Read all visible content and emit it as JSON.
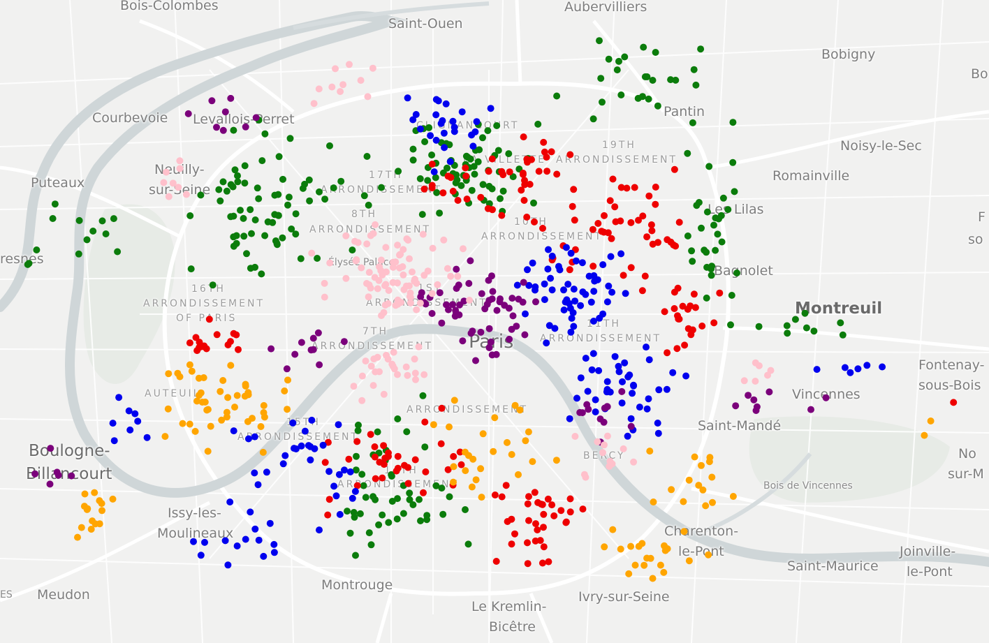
{
  "map": {
    "labels": {
      "bois_colombes": "Bois-Colombes",
      "saint_ouen": "Saint-Ouen",
      "aubervilliers": "Aubervilliers",
      "bobigny": "Bobigny",
      "bo": "Bo",
      "courbevoie": "Courbevoie",
      "levallois": "Levallois-Perret",
      "pantin": "Pantin",
      "noisy": "Noisy-le-Sec",
      "neuilly1": "Neuilly-",
      "neuilly2": "sur-Seine",
      "puteaux": "Puteaux",
      "romainville": "Romainville",
      "les_lilas": "Les Lilas",
      "resnes": "resnes",
      "elysee": "Élysée Palace",
      "bagnolet": "Bagnolet",
      "montreuil": "Montreuil",
      "paris": "Paris",
      "fontenay1": "Fontenay-",
      "fontenay2": "sous-Bois",
      "vincennes": "Vincennes",
      "saint_mande": "Saint-Mandé",
      "boulogne1": "Boulogne-",
      "boulogne2": "Billancourt",
      "bercy": "BERCY",
      "bois_vincennes": "Bois de Vincennes",
      "no1": "No",
      "no2": "sur-M",
      "issy1": "Issy-les-",
      "issy2": "Moulineaux",
      "charenton1": "Charenton-",
      "charenton2": "le-Pont",
      "joinville1": "Joinville-",
      "joinville2": "le-Pont",
      "saint_maurice": "Saint-Maurice",
      "es": "ES",
      "meudon": "Meudon",
      "montrouge": "Montrouge",
      "kremlin1": "Le Kremlin-",
      "kremlin2": "Bicêtre",
      "ivry": "Ivry-sur-Seine",
      "r_so": "so",
      "r_f": "F",
      "clignancourt": "CLIGNANCOURT",
      "villette": "LA VILLETTE",
      "arr19a": "19TH",
      "arr19b": "ARRONDISSEMENT",
      "arr17a": "17TH",
      "arr17b": "ARRONDISSEMENT",
      "arr8a": "8TH",
      "arr8b": "ARRONDISSEMENT",
      "arr10a": "10TH",
      "arr10b": "ARRONDISSEMENT",
      "arr16a": "16TH",
      "arr16b": "ARRONDISSEMENT",
      "arr16c": "OF PARIS",
      "arr1a": "1ST",
      "arr1b": "ARRONDISSEMENT",
      "arr7a": "7TH",
      "arr7b": "ARRONDISSEMENT",
      "arr11a": "11TH",
      "arr11b": "ARRONDISSEMENT",
      "auteuil": "AUTEUIL",
      "arr5b": "ARRONDISSEMENT",
      "arr15a": "15TH",
      "arr15b": "ARRONDISSEMENT",
      "arr14a": "14TH",
      "arr14b": "ARRONDISSEMENT"
    },
    "colors": {
      "green": "#0b7c0b",
      "red": "#ee0000",
      "blue": "#0000ee",
      "purple": "#7b007b",
      "pink": "#ffc0cb",
      "orange": "#ffa500"
    }
  }
}
